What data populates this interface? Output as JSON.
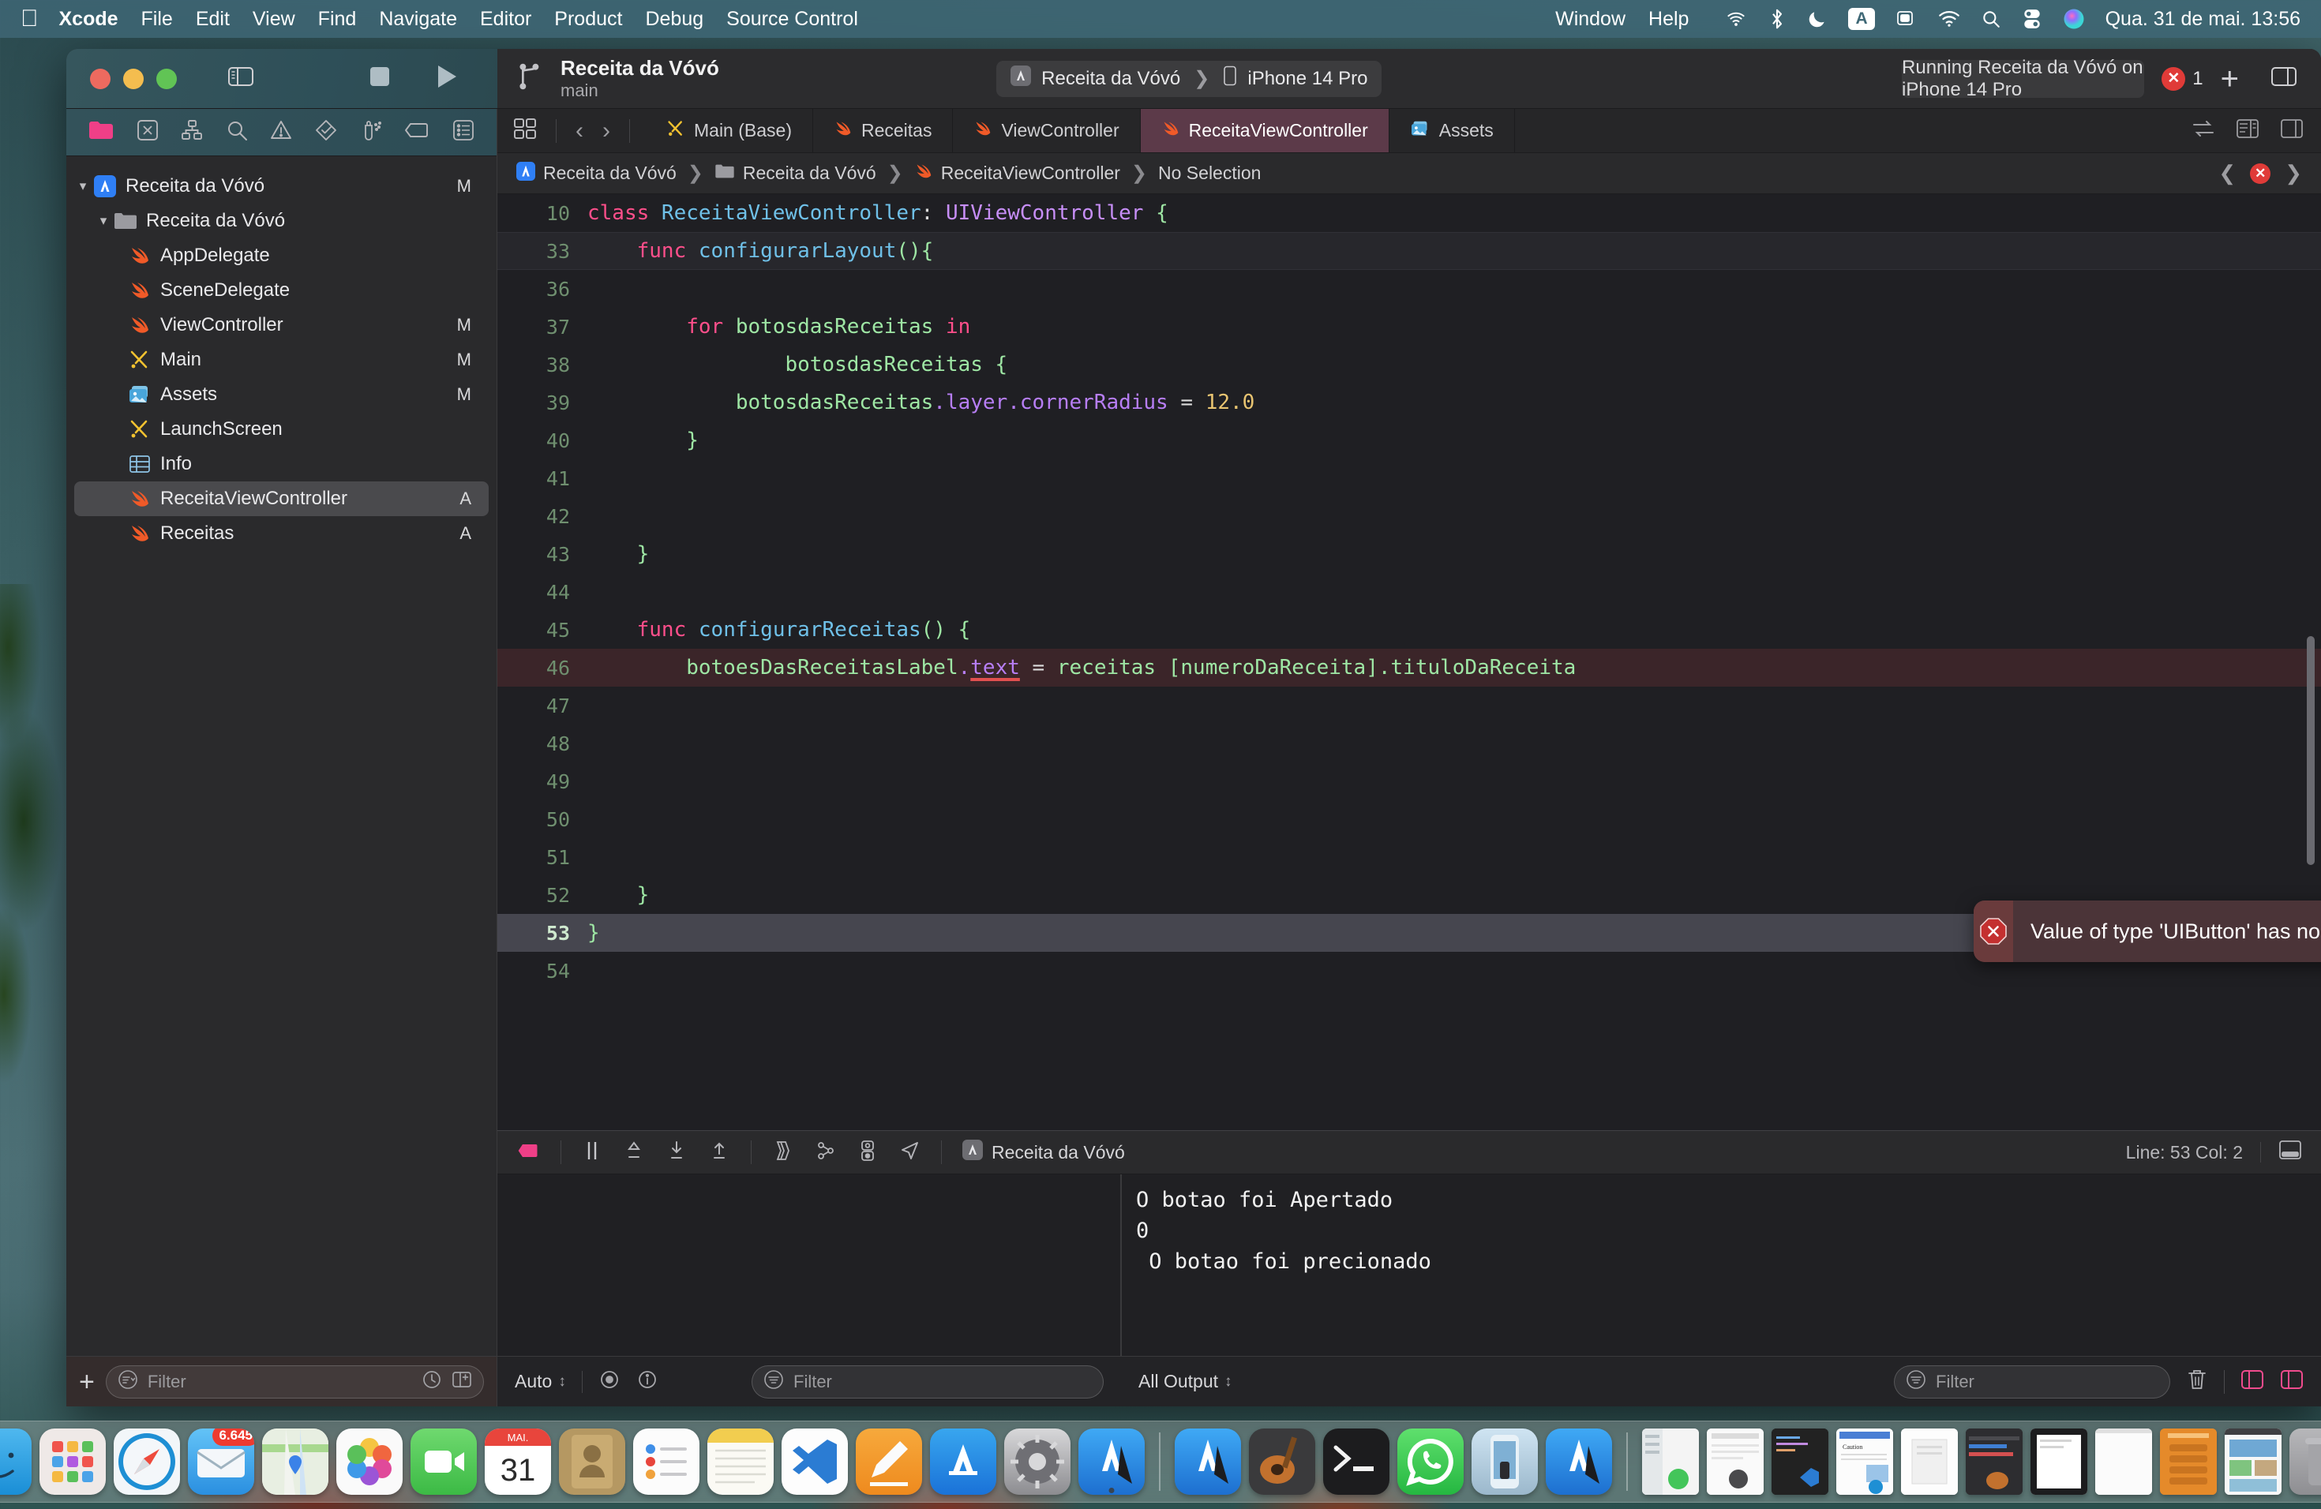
{
  "menubar": {
    "apple": "apple-logo",
    "items": [
      "Xcode",
      "File",
      "Edit",
      "View",
      "Find",
      "Navigate",
      "Editor",
      "Product",
      "Debug",
      "Source Control"
    ],
    "right_items": [
      "Window",
      "Help"
    ],
    "input_source": "A",
    "clock": "Qua. 31 de mai. 13:56",
    "status_icons": [
      "airplay-icon",
      "bluetooth-icon",
      "do-not-disturb-moon-icon",
      "input-source-icon",
      "screen-mirroring-icon",
      "wifi-icon",
      "search-icon",
      "control-center-icon",
      "siri-icon"
    ]
  },
  "titlebar": {
    "project_name": "Receita da Vóvó",
    "branch": "main",
    "scheme": "Receita da Vóvó",
    "destination": "iPhone 14 Pro",
    "status": "Running Receita da Vóvó on iPhone 14 Pro",
    "error_count": "1",
    "stop_button": "stop-button",
    "run_button": "run-button",
    "add_button": "+",
    "icons": [
      "sidebar-toggle-icon",
      "branch-icon",
      "app-icon",
      "device-icon",
      "error-badge-icon",
      "add-icon",
      "inspector-toggle-icon"
    ]
  },
  "navigator": {
    "tabs": [
      "project-navigator-icon",
      "source-control-navigator-icon",
      "symbol-navigator-icon",
      "find-navigator-icon",
      "issue-navigator-icon",
      "test-navigator-icon",
      "debug-navigator-icon",
      "breakpoint-navigator-icon",
      "report-navigator-icon"
    ],
    "tree": [
      {
        "label": "Receita da Vóvó",
        "indent": 0,
        "icon": "xcode-project-icon",
        "mark": "M",
        "twisty": "down",
        "selected": false
      },
      {
        "label": "Receita da Vóvó",
        "indent": 1,
        "icon": "folder-icon",
        "mark": "",
        "twisty": "down",
        "selected": false
      },
      {
        "label": "AppDelegate",
        "indent": 2,
        "icon": "swift-file-icon",
        "mark": "",
        "twisty": "",
        "selected": false
      },
      {
        "label": "SceneDelegate",
        "indent": 2,
        "icon": "swift-file-icon",
        "mark": "",
        "twisty": "",
        "selected": false
      },
      {
        "label": "ViewController",
        "indent": 2,
        "icon": "swift-file-icon",
        "mark": "M",
        "twisty": "",
        "selected": false
      },
      {
        "label": "Main",
        "indent": 2,
        "icon": "storyboard-icon",
        "mark": "M",
        "twisty": "",
        "selected": false
      },
      {
        "label": "Assets",
        "indent": 2,
        "icon": "assets-icon",
        "mark": "M",
        "twisty": "",
        "selected": false
      },
      {
        "label": "LaunchScreen",
        "indent": 2,
        "icon": "storyboard-icon",
        "mark": "",
        "twisty": "",
        "selected": false
      },
      {
        "label": "Info",
        "indent": 2,
        "icon": "plist-icon",
        "mark": "",
        "twisty": "",
        "selected": false
      },
      {
        "label": "ReceitaViewController",
        "indent": 2,
        "icon": "swift-file-icon",
        "mark": "A",
        "twisty": "",
        "selected": true
      },
      {
        "label": "Receitas",
        "indent": 2,
        "icon": "swift-file-icon",
        "mark": "A",
        "twisty": "",
        "selected": false
      }
    ],
    "bottom": {
      "add_label": "+",
      "filter_placeholder": "Filter",
      "filter_value": "",
      "recent_icon": "recent-files-icon",
      "sourcecontrol_icon": "source-control-filter-icon"
    }
  },
  "editor": {
    "tabs": [
      {
        "label": "Main (Base)",
        "icon": "storyboard-icon",
        "active": false
      },
      {
        "label": "Receitas",
        "icon": "swift-file-icon",
        "active": false
      },
      {
        "label": "ViewController",
        "icon": "swift-file-icon",
        "active": false
      },
      {
        "label": "ReceitaViewController",
        "icon": "swift-file-icon",
        "active": true
      },
      {
        "label": "Assets",
        "icon": "assets-icon",
        "active": false
      }
    ],
    "nav_back": "‹",
    "nav_forward": "›",
    "breadcrumb": [
      "Receita da Vóvó",
      "Receita da Vóvó",
      "ReceitaViewController",
      "No Selection"
    ],
    "code_lines": [
      {
        "num": "10",
        "state": "normal",
        "tokens": [
          {
            "t": "class ",
            "c": "kw"
          },
          {
            "t": "ReceitaViewController",
            "c": "fn"
          },
          {
            "t": ": ",
            "c": "plain"
          },
          {
            "t": "UIViewController",
            "c": "ty"
          },
          {
            "t": " {",
            "c": "ctext"
          }
        ]
      },
      {
        "num": "33",
        "state": "banded",
        "tokens": [
          {
            "t": "    ",
            "c": "plain"
          },
          {
            "t": "func ",
            "c": "kw"
          },
          {
            "t": "configurarLayout",
            "c": "fn"
          },
          {
            "t": "(){",
            "c": "ctext"
          }
        ]
      },
      {
        "num": "36",
        "state": "normal",
        "tokens": []
      },
      {
        "num": "37",
        "state": "normal",
        "tokens": [
          {
            "t": "        ",
            "c": "plain"
          },
          {
            "t": "for ",
            "c": "kw"
          },
          {
            "t": "botosdasReceitas ",
            "c": "ctext"
          },
          {
            "t": "in",
            "c": "kw"
          }
        ]
      },
      {
        "num": "38",
        "state": "normal",
        "tokens": [
          {
            "t": "                botosdasReceitas {",
            "c": "ctext"
          }
        ]
      },
      {
        "num": "39",
        "state": "normal",
        "tokens": [
          {
            "t": "            botosdasReceitas",
            "c": "ctext"
          },
          {
            "t": ".layer",
            "c": "prop"
          },
          {
            "t": ".cornerRadius",
            "c": "prop"
          },
          {
            "t": " = ",
            "c": "plain"
          },
          {
            "t": "12.0",
            "c": "num"
          }
        ]
      },
      {
        "num": "40",
        "state": "normal",
        "tokens": [
          {
            "t": "        }",
            "c": "ctext"
          }
        ]
      },
      {
        "num": "41",
        "state": "normal",
        "tokens": []
      },
      {
        "num": "42",
        "state": "normal",
        "tokens": []
      },
      {
        "num": "43",
        "state": "normal",
        "tokens": [
          {
            "t": "    }",
            "c": "ctext"
          }
        ]
      },
      {
        "num": "44",
        "state": "normal",
        "tokens": []
      },
      {
        "num": "45",
        "state": "normal",
        "tokens": [
          {
            "t": "    ",
            "c": "plain"
          },
          {
            "t": "func ",
            "c": "kw"
          },
          {
            "t": "configurarReceitas",
            "c": "fn"
          },
          {
            "t": "() {",
            "c": "ctext"
          }
        ]
      },
      {
        "num": "46",
        "state": "errline",
        "tokens": [
          {
            "t": "        botoesDasReceitasLabel",
            "c": "ctext"
          },
          {
            "t": ".",
            "c": "prop"
          },
          {
            "t": "text",
            "c": "prop squig"
          },
          {
            "t": " = ",
            "c": "plain"
          },
          {
            "t": "receitas [numeroDaReceita]",
            "c": "ctext"
          },
          {
            "t": ".tituloDaReceita",
            "c": "ctext"
          }
        ]
      },
      {
        "num": "47",
        "state": "normal",
        "tokens": []
      },
      {
        "num": "48",
        "state": "normal",
        "tokens": []
      },
      {
        "num": "49",
        "state": "normal",
        "tokens": []
      },
      {
        "num": "50",
        "state": "normal",
        "tokens": []
      },
      {
        "num": "51",
        "state": "normal",
        "tokens": []
      },
      {
        "num": "52",
        "state": "normal",
        "tokens": [
          {
            "t": "    }",
            "c": "ctext"
          }
        ]
      },
      {
        "num": "53",
        "state": "cur",
        "tokens": [
          {
            "t": "}",
            "c": "ctext"
          }
        ]
      },
      {
        "num": "54",
        "state": "normal",
        "tokens": []
      }
    ],
    "error_popup": {
      "message": "Value of type 'UIButton' has no member 'text'",
      "close_label": "✕",
      "icon": "error-octagon-icon"
    }
  },
  "debug": {
    "toolbar_icons": [
      "deactivate-breakpoints-icon",
      "pause-icon",
      "step-over-icon",
      "step-into-icon",
      "step-out-icon",
      "view-hierarchy-icon",
      "memory-graph-icon",
      "environment-overrides-icon",
      "location-simulate-icon"
    ],
    "process_label": "Receita da Vóvó",
    "line_col": "Line: 53  Col: 2",
    "console_output": "O botao foi Apertado\n0\n O botao foi precionado",
    "variables_scope": "Auto",
    "variables_filter_placeholder": "Filter",
    "variables_filter_value": "",
    "output_scope": "All Output",
    "console_filter_placeholder": "Filter",
    "console_filter_value": "",
    "trash_icon": "clear-console-icon",
    "panel_toggle_left": "variables-pane-toggle-icon",
    "panel_toggle_right": "console-pane-toggle-icon"
  },
  "dock": {
    "apps": [
      {
        "name": "finder",
        "badge": ""
      },
      {
        "name": "launchpad",
        "badge": ""
      },
      {
        "name": "safari",
        "badge": ""
      },
      {
        "name": "mail",
        "badge": "6.645"
      },
      {
        "name": "maps",
        "badge": ""
      },
      {
        "name": "photos",
        "badge": ""
      },
      {
        "name": "facetime",
        "badge": ""
      },
      {
        "name": "calendar",
        "badge": "31",
        "sublabel": "MAI."
      },
      {
        "name": "contacts",
        "badge": ""
      },
      {
        "name": "reminders",
        "badge": ""
      },
      {
        "name": "notes",
        "badge": ""
      },
      {
        "name": "vscode",
        "badge": ""
      },
      {
        "name": "freeform",
        "badge": ""
      },
      {
        "name": "appstore",
        "badge": ""
      },
      {
        "name": "system-settings",
        "badge": ""
      },
      {
        "name": "xcode",
        "badge": ""
      },
      {
        "name": "xcode-beta",
        "badge": ""
      },
      {
        "name": "garageband",
        "badge": ""
      },
      {
        "name": "terminal",
        "badge": ""
      },
      {
        "name": "whatsapp",
        "badge": ""
      },
      {
        "name": "simulator",
        "badge": ""
      },
      {
        "name": "xcode-2",
        "badge": ""
      }
    ],
    "minimized": [
      {
        "name": "window-whatsapp"
      },
      {
        "name": "window-document"
      },
      {
        "name": "window-vscode"
      },
      {
        "name": "window-pages"
      },
      {
        "name": "window-preview"
      },
      {
        "name": "window-garageband"
      },
      {
        "name": "window-simulator"
      },
      {
        "name": "window-white"
      },
      {
        "name": "window-orange-app"
      },
      {
        "name": "window-photos-app"
      }
    ],
    "trash": "trash-icon"
  },
  "colors": {
    "accent_pink": "#ef4b8d",
    "error_red": "#e03b38",
    "tab_active": "#5c3a49",
    "editor_bg": "#1f1f23"
  }
}
